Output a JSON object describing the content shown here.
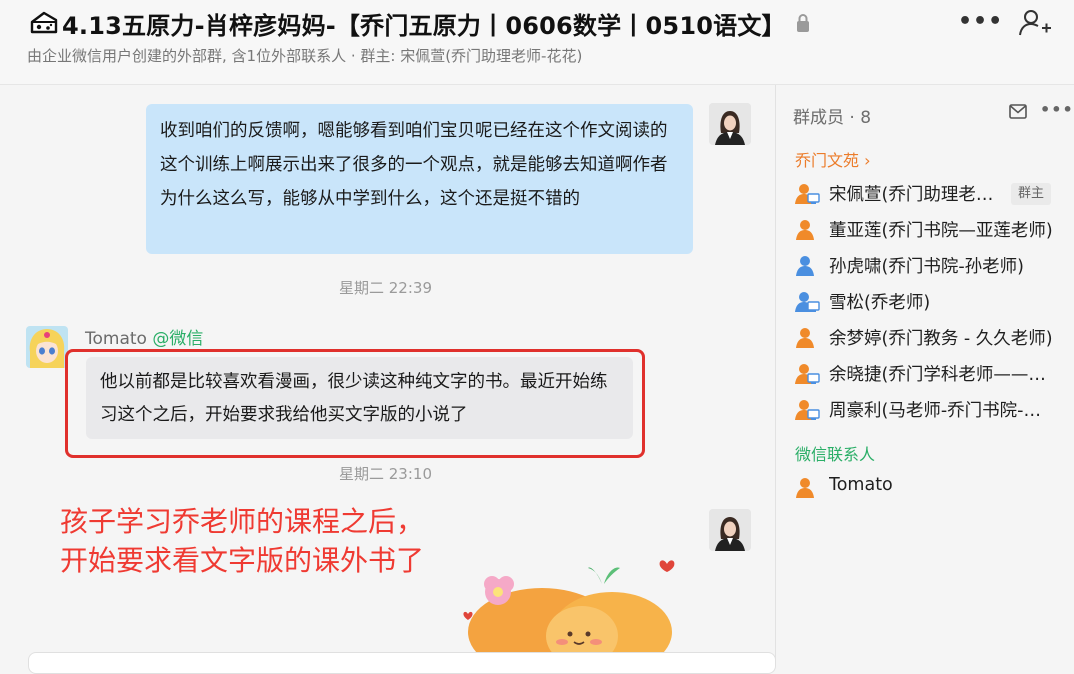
{
  "header": {
    "title": "4.13五原力-肖梓彦妈妈-【乔门五原力丨0606数学丨0510语文】",
    "subtitle": "由企业微信用户创建的外部群, 含1位外部联系人 · 群主: 宋佩萱(乔门助理老师-花花)",
    "more_icon": "more-horizontal-icon",
    "add_member_icon": "add-user-icon"
  },
  "chat": {
    "messages": [
      {
        "side": "right",
        "text": "收到咱们的反馈啊，嗯能够看到咱们宝贝呢已经在这个作文阅读的这个训练上啊展示出来了很多的一个观点，就是能够去知道啊作者为什么这么写，能够从中学到什么，这个还是挺不错的"
      },
      {
        "side": "left",
        "sender_name": "Tomato",
        "sender_tag": "@微信",
        "text": "他以前都是比较喜欢看漫画，很少读这种纯文字的书。最近开始练习这个之后，开始要求我给他买文字版的小说了"
      }
    ],
    "time1": "星期二 22:39",
    "time2": "星期二 23:10",
    "annotation_line1": "孩子学习乔老师的课程之后，",
    "annotation_line2": "开始要求看文字版的课外书了"
  },
  "members_panel": {
    "heading": "群成员 · 8",
    "section_company": "乔门文苑",
    "section_wechat": "微信联系人",
    "owner_badge": "群主",
    "members": [
      {
        "name": "宋佩萱(乔门助理老师-花花)",
        "icon": "user-admin-icon"
      },
      {
        "name": "董亚莲(乔门书院—亚莲老师)",
        "icon": "user-icon"
      },
      {
        "name": "孙虎啸(乔门书院-孙老师)",
        "icon": "user-icon"
      },
      {
        "name": "雪松(乔老师)",
        "icon": "user-screen-icon"
      },
      {
        "name": "余梦婷(乔门教务 - 久久老师)",
        "icon": "user-icon"
      },
      {
        "name": "余晓捷(乔门学科老师——晓捷老师)",
        "icon": "user-screen-icon"
      },
      {
        "name": "周豪利(马老师-乔门书院-豪利老师)",
        "icon": "user-screen-icon"
      }
    ],
    "wechat_members": [
      {
        "name": "Tomato",
        "icon": "user-icon"
      }
    ]
  },
  "colors": {
    "my_bubble": "#c9e5fa",
    "other_bubble": "#e9e9eb",
    "highlight_red": "#e0302c",
    "annotation_red": "#ef3a32",
    "company_orange": "#ec7c2a",
    "wechat_green": "#2aae67"
  }
}
